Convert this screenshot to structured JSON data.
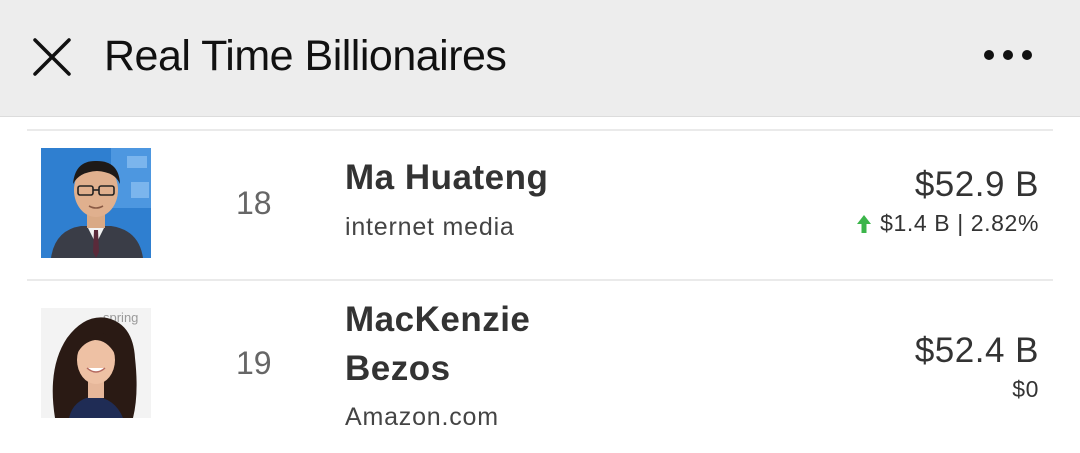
{
  "header": {
    "title": "Real Time Billionaires",
    "close_icon": "close-icon",
    "more_icon": "more-horizontal-icon"
  },
  "colors": {
    "header_bg": "#ededed",
    "up": "#3bb54a",
    "text": "#333333"
  },
  "list": [
    {
      "rank": "18",
      "name": "Ma Huateng",
      "industry": "internet media",
      "net_worth": "$52.9 B",
      "change": "$1.4 B | 2.82%",
      "trend_icon": "arrow-up-icon"
    },
    {
      "rank": "19",
      "name": "MacKenzie Bezos",
      "industry": "Amazon.com",
      "net_worth": "$52.4 B",
      "change": "$0",
      "trend_icon": ""
    }
  ]
}
